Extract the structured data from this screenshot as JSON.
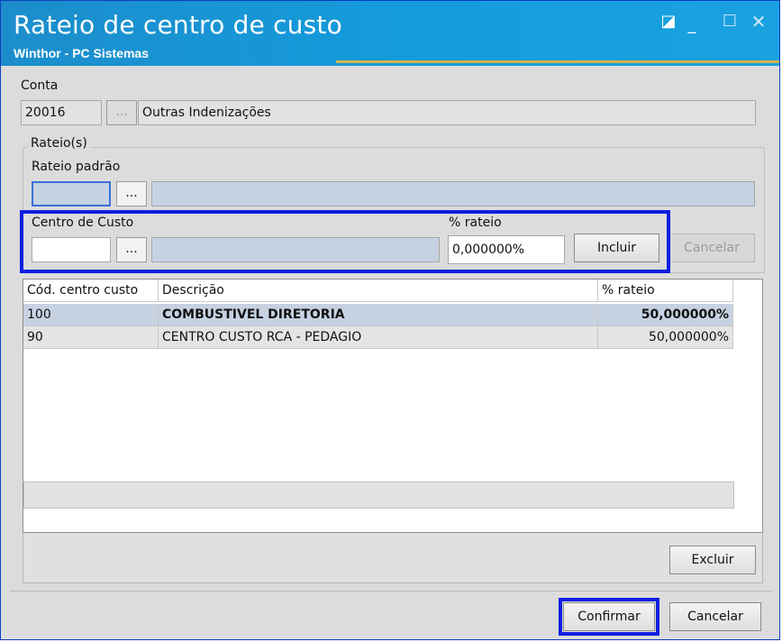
{
  "window": {
    "title": "Rateio de centro de custo",
    "subtitle": "Winthor - PC Sistemas",
    "controls": {
      "restore": "◪",
      "minimize": "_",
      "maximize": "☐",
      "close": "✕"
    }
  },
  "conta": {
    "label": "Conta",
    "code": "20016",
    "lookup": "...",
    "description": "Outras Indenizações"
  },
  "rateios": {
    "group_label": "Rateio(s)",
    "padrao_label": "Rateio padrão",
    "padrao_value": "",
    "padrao_lookup": "...",
    "padrao_description": ""
  },
  "centro": {
    "label": "Centro de Custo",
    "value": "",
    "lookup": "...",
    "description": "",
    "percent_label": "% rateio",
    "percent_value": "0,000000%",
    "include_button": "Incluir",
    "cancel_button": "Cancelar"
  },
  "table": {
    "headers": [
      "Cód. centro custo",
      "Descrição",
      "% rateio"
    ],
    "rows": [
      {
        "code": "100",
        "description": "COMBUSTIVEL DIRETORIA",
        "percent": "50,000000%"
      },
      {
        "code": "90",
        "description": "CENTRO CUSTO RCA - PEDAGIO",
        "percent": "50,000000%"
      }
    ]
  },
  "buttons": {
    "excluir": "Excluir",
    "confirmar": "Confirmar",
    "cancelar": "Cancelar"
  },
  "colors": {
    "title_bar": "#149cdc",
    "highlight": "#0d1fe0",
    "selected_row": "#c6d2e2"
  }
}
